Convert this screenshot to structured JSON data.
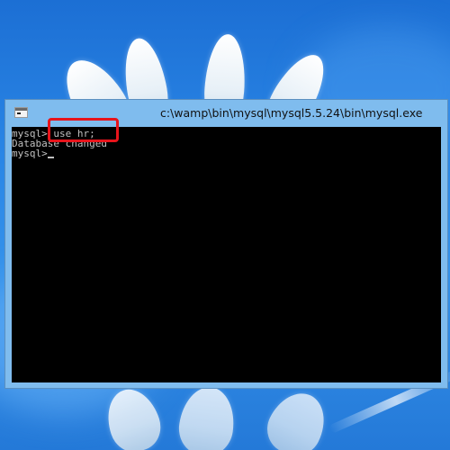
{
  "window": {
    "title": "c:\\wamp\\bin\\mysql\\mysql5.5.24\\bin\\mysql.exe",
    "icon": "console-app-icon"
  },
  "console": {
    "lines": [
      "mysql> use hr;",
      "Database changed",
      "mysql>"
    ],
    "text_color": "#c0c0c0",
    "background": "#000000"
  },
  "annotation": {
    "highlight_color": "#e8141b"
  },
  "desktop": {
    "background_color": "#2a86e6"
  }
}
